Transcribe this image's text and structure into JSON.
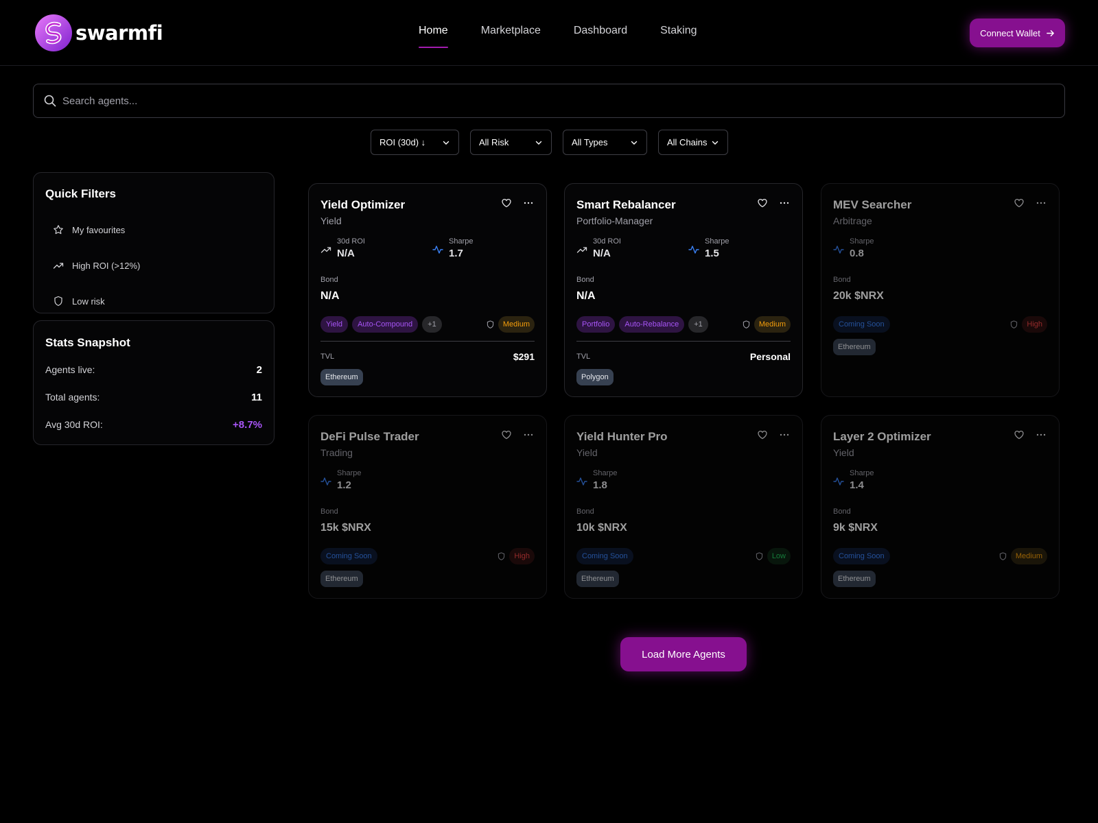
{
  "brand": {
    "name": "swarmfi"
  },
  "nav": {
    "items": [
      "Home",
      "Marketplace",
      "Dashboard",
      "Staking"
    ],
    "active": "Home"
  },
  "header": {
    "connect_label": "Connect Wallet"
  },
  "search": {
    "placeholder": "Search agents..."
  },
  "filters": {
    "sort": "ROI (30d) ↓",
    "risk": "All Risk",
    "types": "All Types",
    "chains": "All Chains"
  },
  "quick_filters": {
    "title": "Quick Filters",
    "items": [
      "My favourites",
      "High ROI (>12%)",
      "Low risk"
    ]
  },
  "stats": {
    "title": "Stats Snapshot",
    "rows": [
      {
        "label": "Agents live:",
        "value": "2"
      },
      {
        "label": "Total agents:",
        "value": "11"
      },
      {
        "label": "Avg 30d ROI:",
        "value": "+8.7%"
      }
    ]
  },
  "cards": [
    {
      "title": "Yield Optimizer",
      "subtitle": "Yield",
      "roi_label": "30d ROI",
      "roi": "N/A",
      "sharpe_label": "Sharpe",
      "sharpe": "1.7",
      "bond_label": "Bond",
      "bond": "N/A",
      "tags": [
        "Yield",
        "Auto-Compound",
        "+1"
      ],
      "risk": "Medium",
      "tvl_label": "TVL",
      "tvl": "$291",
      "chain": "Ethereum"
    },
    {
      "title": "Smart Rebalancer",
      "subtitle": "Portfolio-Manager",
      "roi_label": "30d ROI",
      "roi": "N/A",
      "sharpe_label": "Sharpe",
      "sharpe": "1.5",
      "bond_label": "Bond",
      "bond": "N/A",
      "tags": [
        "Portfolio",
        "Auto-Rebalance",
        "+1"
      ],
      "risk": "Medium",
      "tvl_label": "TVL",
      "tvl": "Personal",
      "chain": "Polygon"
    },
    {
      "title": "MEV Searcher",
      "subtitle": "Arbitrage",
      "sharpe_label": "Sharpe",
      "sharpe": "0.8",
      "bond_label": "Bond",
      "bond": "20k $NRX",
      "status": "Coming Soon",
      "risk": "High",
      "chain": "Ethereum"
    },
    {
      "title": "DeFi Pulse Trader",
      "subtitle": "Trading",
      "sharpe_label": "Sharpe",
      "sharpe": "1.2",
      "bond_label": "Bond",
      "bond": "15k $NRX",
      "status": "Coming Soon",
      "risk": "High",
      "chain": "Ethereum"
    },
    {
      "title": "Yield Hunter Pro",
      "subtitle": "Yield",
      "sharpe_label": "Sharpe",
      "sharpe": "1.8",
      "bond_label": "Bond",
      "bond": "10k $NRX",
      "status": "Coming Soon",
      "risk": "Low",
      "chain": "Ethereum"
    },
    {
      "title": "Layer 2 Optimizer",
      "subtitle": "Yield",
      "sharpe_label": "Sharpe",
      "sharpe": "1.4",
      "bond_label": "Bond",
      "bond": "9k $NRX",
      "status": "Coming Soon",
      "risk": "Medium",
      "chain": "Ethereum"
    }
  ],
  "load_more_label": "Load More Agents",
  "colors": {
    "accent": "#86108f",
    "accent_text": "#a855f7",
    "risk_medium": "#f59e0b",
    "risk_high": "#ef4444",
    "risk_low": "#22c55e",
    "coming_soon": "#3b82f6"
  }
}
